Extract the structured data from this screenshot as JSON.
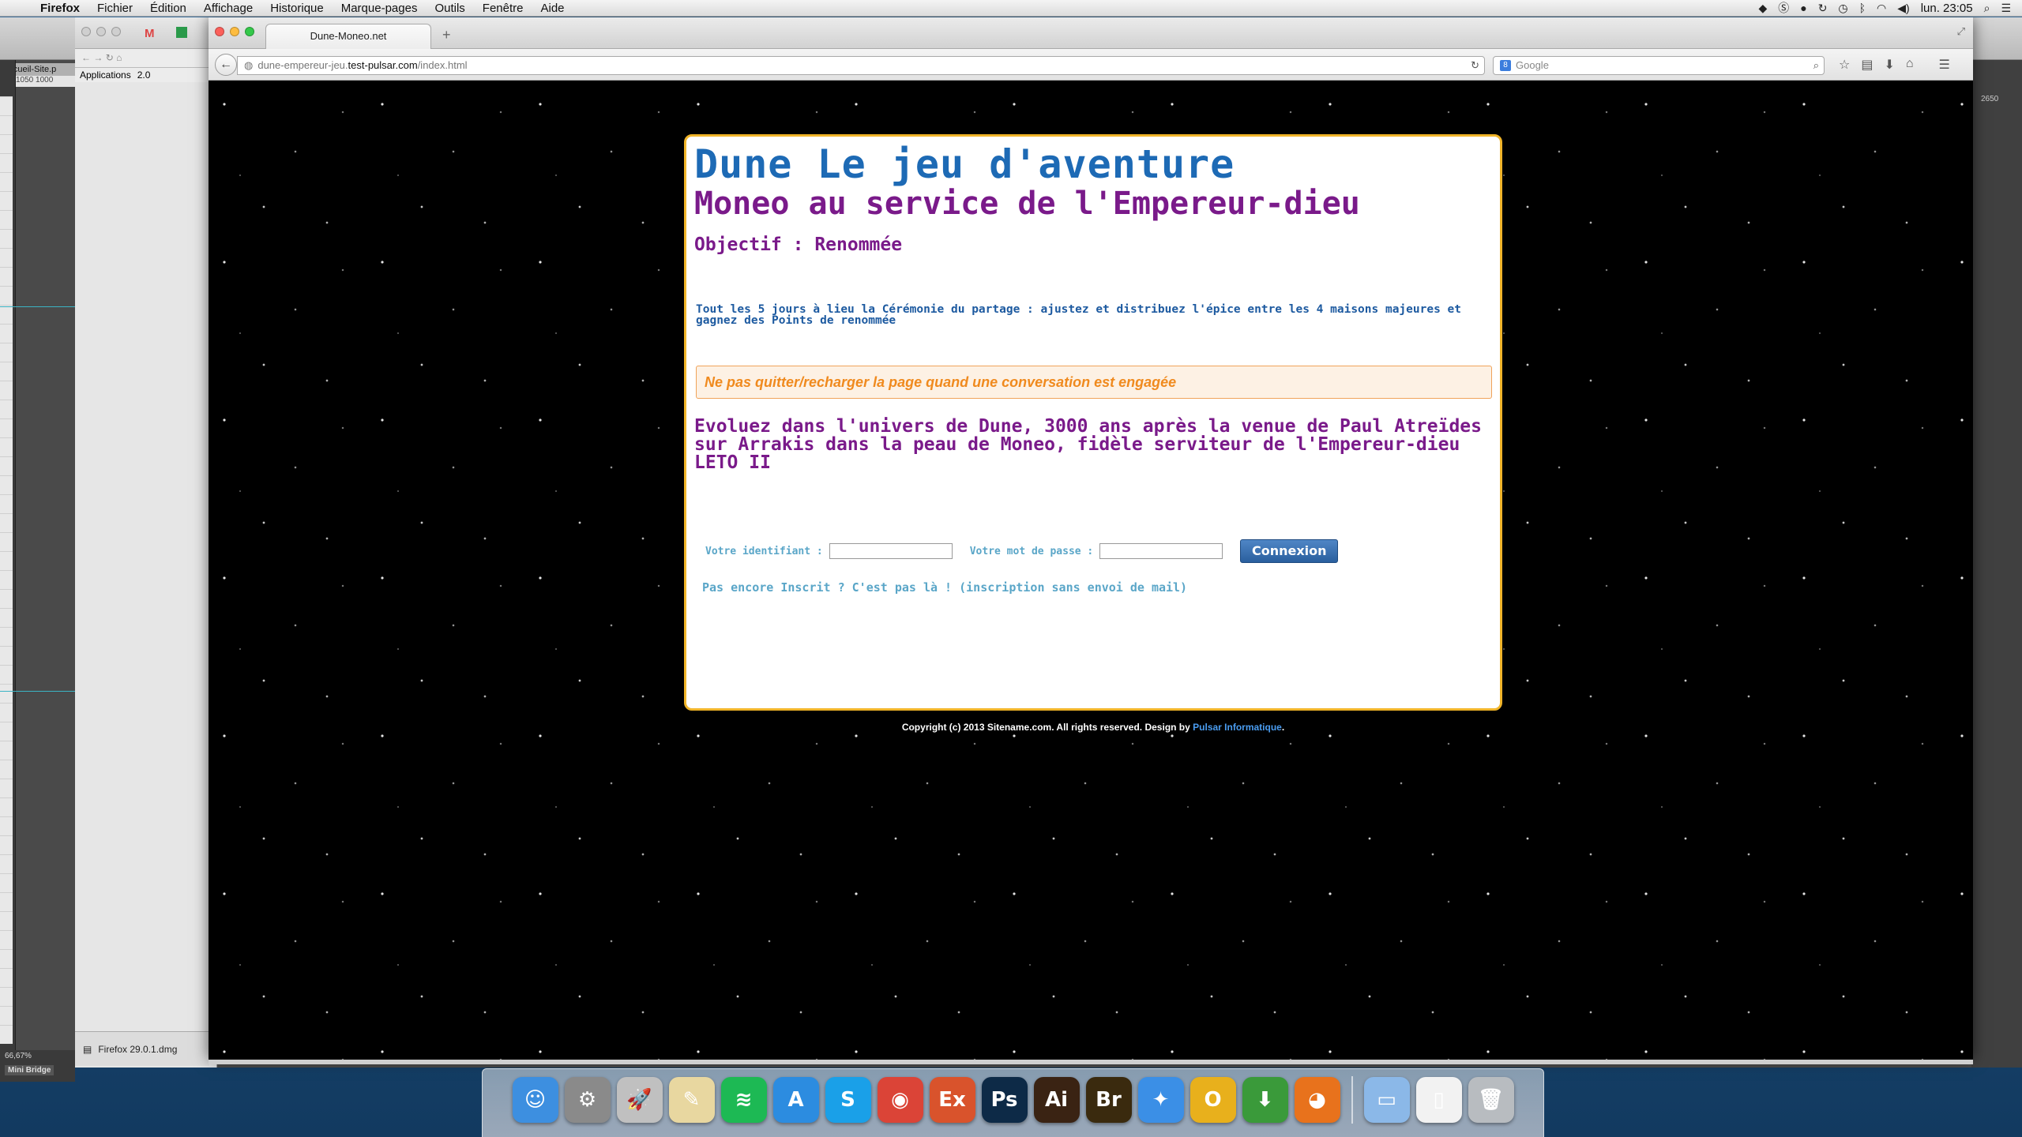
{
  "menubar": {
    "app": "Firefox",
    "items": [
      "Fichier",
      "Édition",
      "Affichage",
      "Historique",
      "Marque-pages",
      "Outils",
      "Fenêtre",
      "Aide"
    ],
    "clock": "lun. 23:05"
  },
  "background": {
    "doc_tab": "Accueil-Site.p",
    "ruler": "1050   1000",
    "zoom": "66,67%",
    "mini_bridge": "Mini Bridge",
    "right_value": "2650",
    "bookmarks": [
      "Applications",
      "2.0"
    ],
    "download": "Firefox 29.0.1.dmg"
  },
  "browser": {
    "tab_title": "Dune-Moneo.net",
    "url_prefix": "dune-empereur-jeu.",
    "url_host": "test-pulsar.com",
    "url_path": "/index.html",
    "search_placeholder": "Google"
  },
  "page": {
    "title": "Dune Le jeu d'aventure",
    "subtitle": "Moneo au service de l'Empereur-dieu",
    "objective": "Objectif : Renommée",
    "info": "Tout les 5 jours à lieu la Cérémonie du partage : ajustez et distribuez l'épice entre les 4 maisons majeures et gagnez des Points de renommée",
    "warning": "Ne pas quitter/recharger la page quand une conversation est engagée",
    "intro": "Evoluez dans l'univers de Dune, 3000 ans après la venue de Paul Atreïdes sur Arrakis dans la peau de Moneo, fidèle serviteur de l'Empereur-dieu LETO II",
    "login_label": "Votre identifiant :",
    "password_label": "Votre mot de passe :",
    "login_value": "",
    "password_value": "",
    "connect_button": "Connexion",
    "register_link": "Pas encore Inscrit ? C'est pas là ! (inscription sans envoi de mail)",
    "copyright_text": "Copyright (c) 2013 Sitename.com. All rights reserved. Design by ",
    "copyright_link": "Pulsar Informatique",
    "copyright_end": "."
  },
  "colors": {
    "title_blue": "#1d6ab5",
    "purple": "#7a1a8a",
    "frame_gold": "#f0b429",
    "warning_orange": "#f08a1e",
    "link_cyan": "#5aa6c8"
  },
  "dock": {
    "apps": [
      {
        "icon": "finder-icon",
        "label": "☺",
        "color": "#3d8fe0"
      },
      {
        "icon": "system-preferences-icon",
        "label": "⚙",
        "color": "#8a8a8a"
      },
      {
        "icon": "launchpad-icon",
        "label": "🚀",
        "color": "#c0c0c0"
      },
      {
        "icon": "preview-icon",
        "label": "✎",
        "color": "#e8d7a0"
      },
      {
        "icon": "spotify-icon",
        "label": "≋",
        "color": "#1db954"
      },
      {
        "icon": "app-store-icon",
        "label": "A",
        "color": "#2c8ce0"
      },
      {
        "icon": "skype-icon",
        "label": "S",
        "color": "#1aa0e8"
      },
      {
        "icon": "chrome-icon",
        "label": "◉",
        "color": "#db4437"
      },
      {
        "icon": "extension-manager-icon",
        "label": "Ex",
        "color": "#d9532c"
      },
      {
        "icon": "photoshop-icon",
        "label": "Ps",
        "color": "#0d2a47"
      },
      {
        "icon": "illustrator-icon",
        "label": "Ai",
        "color": "#3a2313"
      },
      {
        "icon": "bridge-icon",
        "label": "Br",
        "color": "#3a2a0e"
      },
      {
        "icon": "safari-icon",
        "label": "✦",
        "color": "#3b8fe6"
      },
      {
        "icon": "opera-icon",
        "label": "O",
        "color": "#e8b01c"
      },
      {
        "icon": "transmission-icon",
        "label": "⬇",
        "color": "#3a9a3a"
      },
      {
        "icon": "firefox-icon",
        "label": "◕",
        "color": "#e8721c"
      }
    ],
    "right_items": [
      {
        "icon": "folder-icon",
        "label": "▭",
        "color": "#8bb8e8"
      },
      {
        "icon": "document-icon",
        "label": "▯",
        "color": "#f2f2f2"
      },
      {
        "icon": "trash-icon",
        "label": "🗑",
        "color": "#b8bcc0"
      }
    ]
  }
}
